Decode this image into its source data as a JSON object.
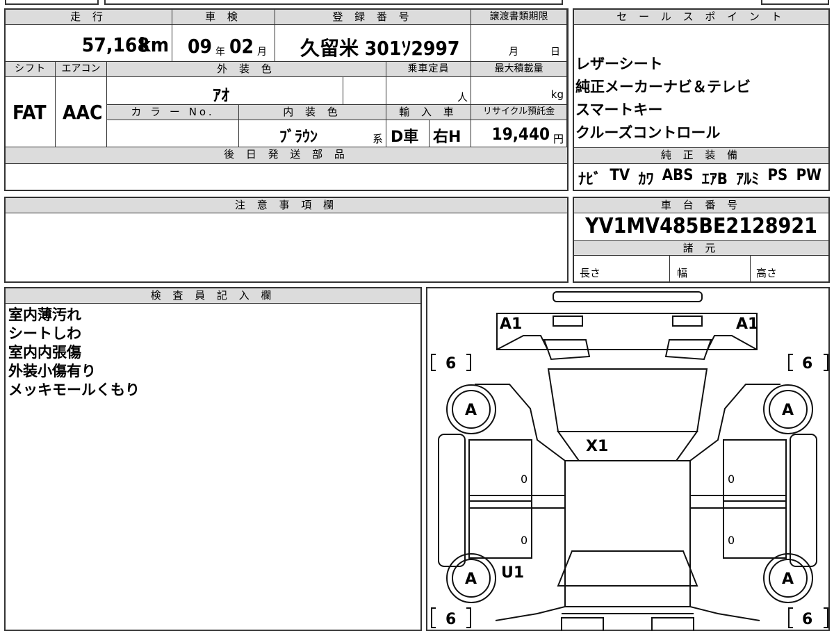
{
  "top_table": {
    "mileage_label": "走 行",
    "mileage_value": "57,168",
    "mileage_unit": "km",
    "inspection_label": "車 検",
    "inspection_year": "09",
    "inspection_year_unit": "年",
    "inspection_month": "02",
    "inspection_month_unit": "月",
    "reg_label": "登 録 番 号",
    "reg_value": "久留米 301ｿ2997",
    "transfer_label": "譲渡書類期限",
    "transfer_month": "月",
    "transfer_day": "日",
    "shift_label": "シフト",
    "shift_value": "FAT",
    "ac_label": "エアコン",
    "ac_value": "AAC",
    "exterior_label": "外 装 色",
    "exterior_value": "ｱｵ",
    "capacity_label": "乗車定員",
    "capacity_unit": "人",
    "maxload_label": "最大積載量",
    "maxload_unit": "kg",
    "colorno_label": "カ ラ ー No.",
    "interior_label": "内 装 色",
    "interior_value": "ﾌﾞﾗｳﾝ",
    "interior_suffix": "系",
    "import_label": "輸 入 車",
    "import_d": "D車",
    "import_h": "右H",
    "recycle_label": "リサイクル預託金",
    "recycle_value": "19,440",
    "recycle_unit": "円",
    "parts_label": "後 日 発 送 部 品"
  },
  "sales_points": {
    "label": "セ ー ル ス ポ イ ン ト",
    "items": [
      "レザーシート",
      "純正メーカーナビ＆テレビ",
      "スマートキー",
      "クルーズコントロール"
    ]
  },
  "equipment": {
    "label": "純 正 装 備",
    "items": [
      "ﾅﾋﾞ",
      "TV",
      "ｶﾜ",
      "ABS",
      "ｴｱB",
      "ｱﾙﾐ",
      "PS",
      "PW"
    ]
  },
  "notes": {
    "label": "注 意 事 項 欄"
  },
  "chassis": {
    "label": "車 台 番 号",
    "value": "YV1MV485BE2128921",
    "spec_label": "諸 元",
    "length_label": "長さ",
    "width_label": "幅",
    "height_label": "高さ"
  },
  "inspector": {
    "label": "検 査 員 記 入 欄",
    "lines": [
      "室内薄汚れ",
      "シートしわ",
      "室内内張傷",
      "外装小傷有り",
      "メッキモールくもり"
    ]
  },
  "diagram": {
    "marks": {
      "a1_left": "A1",
      "a1_right": "A1",
      "tire_tl": "6",
      "tire_tr": "6",
      "tire_bl": "6",
      "tire_br": "6",
      "wheel_tl": "A",
      "wheel_tr": "A",
      "wheel_bl": "A",
      "wheel_br": "A",
      "x1": "X1",
      "u1": "U1",
      "door_fl": "0",
      "door_fr": "0",
      "door_rl": "0",
      "door_rr": "0"
    }
  }
}
